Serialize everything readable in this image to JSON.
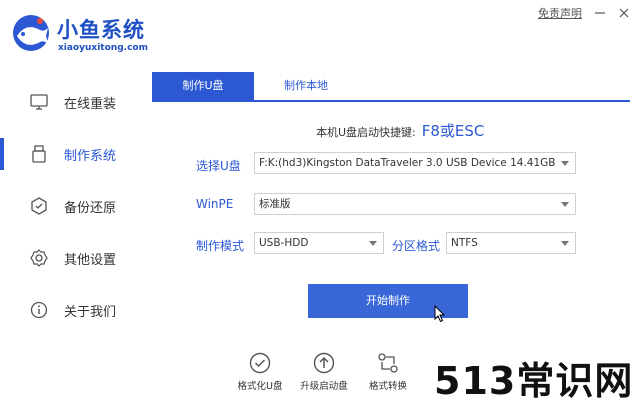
{
  "header": {
    "app_name": "小鱼系统",
    "app_url": "xiaoyuxitong.com",
    "disclaimer": "免责声明"
  },
  "sidebar": {
    "items": [
      {
        "label": "在线重装",
        "icon": "monitor-icon"
      },
      {
        "label": "制作系统",
        "icon": "usb-icon",
        "active": true
      },
      {
        "label": "备份还原",
        "icon": "backup-icon"
      },
      {
        "label": "其他设置",
        "icon": "gear-icon"
      },
      {
        "label": "关于我们",
        "icon": "info-icon"
      }
    ]
  },
  "tabs": [
    {
      "label": "制作U盘",
      "active": true
    },
    {
      "label": "制作本地"
    }
  ],
  "main": {
    "hotkey_label": "本机U盘启动快捷键:",
    "hotkey_value": "F8或ESC",
    "usb_label": "选择U盘",
    "usb_value": "F:K:(hd3)Kingston DataTraveler 3.0 USB Device 14.41GB",
    "winpe_label": "WinPE",
    "winpe_value": "标准版",
    "mode_label": "制作模式",
    "mode_value": "USB-HDD",
    "partition_label": "分区格式",
    "partition_value": "NTFS",
    "start_button": "开始制作"
  },
  "tools": [
    {
      "label": "格式化U盘",
      "icon": "check-circle-icon"
    },
    {
      "label": "升级启动盘",
      "icon": "upload-circle-icon"
    },
    {
      "label": "格式转换",
      "icon": "convert-icon"
    },
    {
      "label": "模",
      "icon": "tool-icon"
    }
  ],
  "watermark": "513常识网",
  "colors": {
    "accent": "#2c58d3",
    "button": "#3a67d8"
  }
}
